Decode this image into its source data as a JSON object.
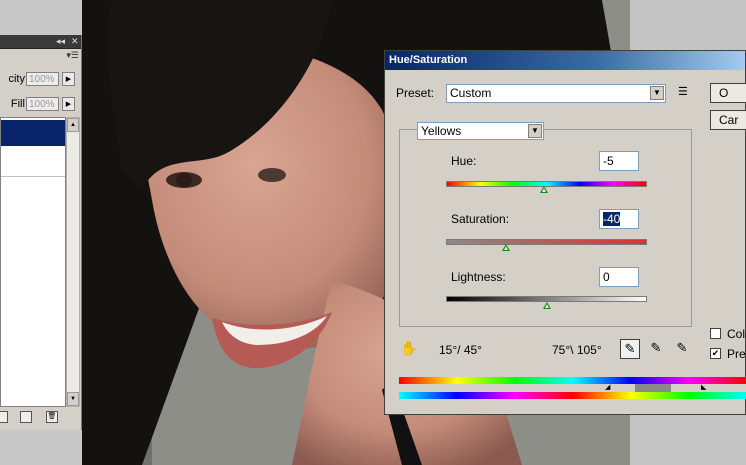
{
  "layers_panel": {
    "opacity_label": "city:",
    "opacity_value": "100%",
    "fill_label": "Fill:",
    "fill_value": "100%"
  },
  "dialog": {
    "title": "Hue/Saturation",
    "preset_label": "Preset:",
    "preset_value": "Custom",
    "channel_value": "Yellows",
    "hue_label": "Hue:",
    "hue_value": "-5",
    "saturation_label": "Saturation:",
    "saturation_value": "-40",
    "lightness_label": "Lightness:",
    "lightness_value": "0",
    "range_left": "15°/ 45°",
    "range_right": "75°\\ 105°",
    "ok_label": "O",
    "cancel_label": "Car",
    "colorize_label": "Colo",
    "preview_label": "Prev",
    "preview_checked": "✔",
    "sliders": {
      "hue": 0.49,
      "saturation": 0.3,
      "lightness": 0.5
    }
  },
  "colors": {
    "accent": "#0a246a",
    "thumb": "#138a1c"
  }
}
